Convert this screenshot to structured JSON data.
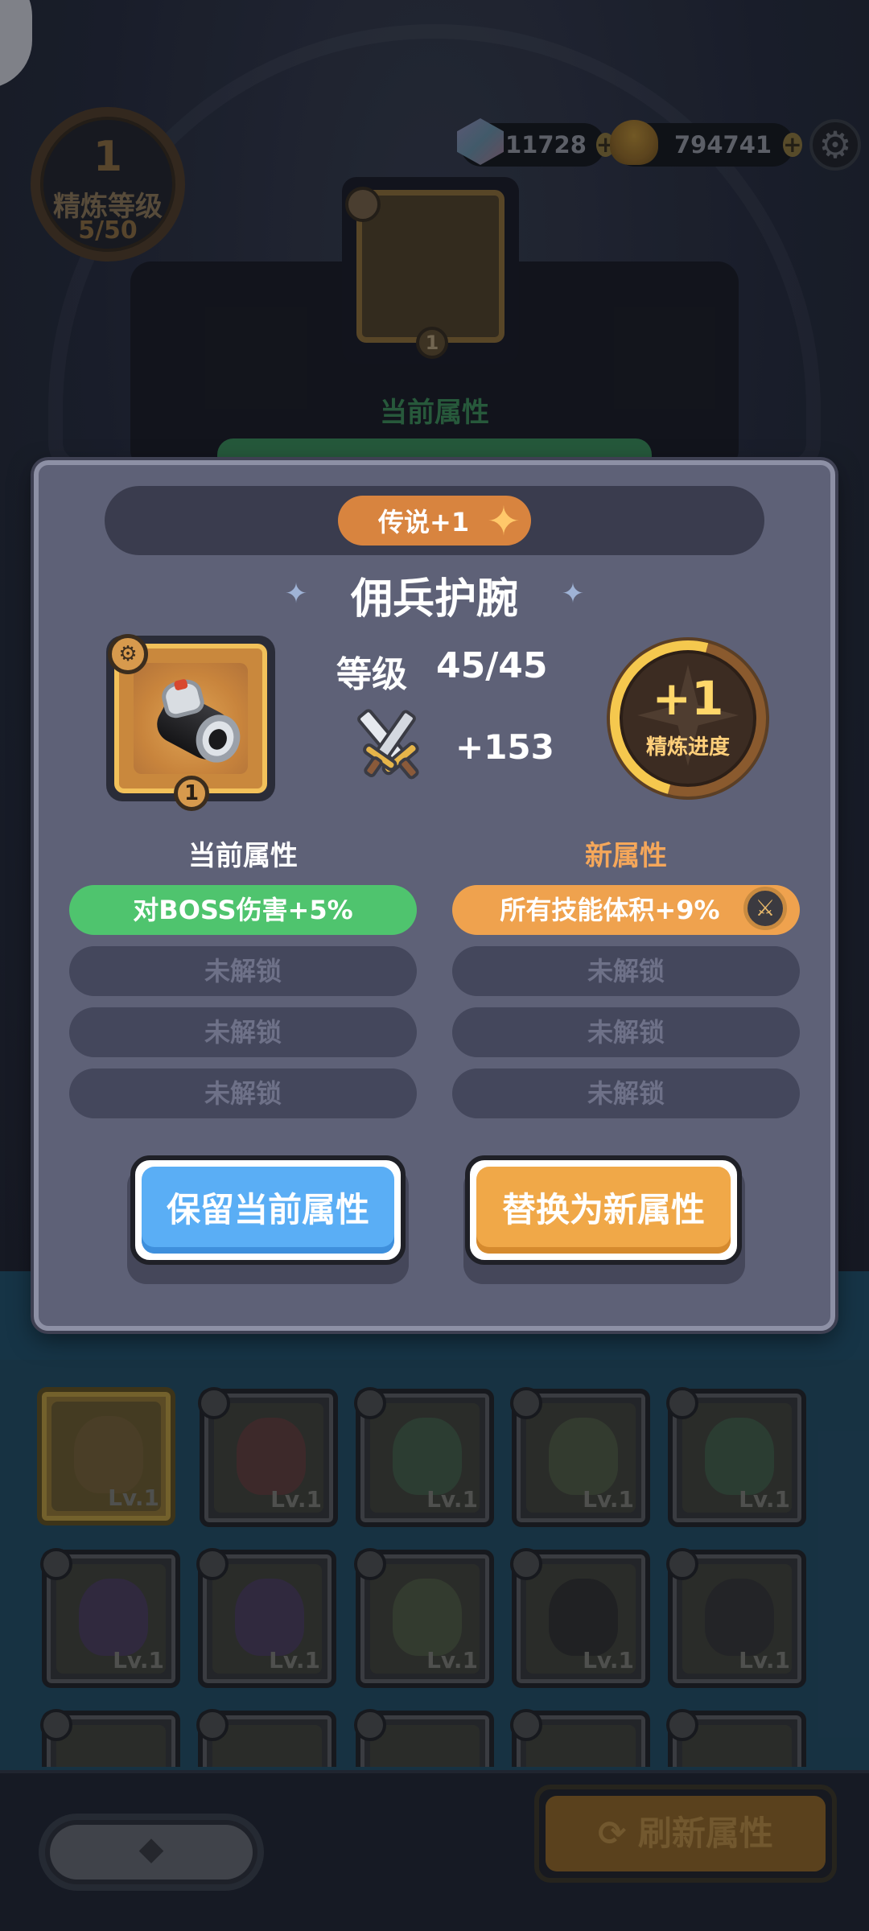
{
  "header": {
    "refine_badge": {
      "level": "1",
      "label": "精炼等级",
      "count": "5/50"
    },
    "gems": "11728",
    "gold": "794741",
    "plus_symbol": "+",
    "gear_symbol": "⚙"
  },
  "background": {
    "current_attr_title": "当前属性",
    "slot_level": "1"
  },
  "modal": {
    "rarity_tag": "传说+1",
    "rarity_spark": "✦",
    "item_name": "佣兵护腕",
    "name_ornament": "✦",
    "item_type_symbol": "⚙",
    "item_level_badge": "1",
    "level_label": "等级",
    "level_value": "45/45",
    "attack_value": "+153",
    "refine_progress": {
      "value": "+1",
      "label": "精炼进度"
    },
    "current_title": "当前属性",
    "new_title": "新属性",
    "current_attrs": [
      "对BOSS伤害+5%",
      "未解锁",
      "未解锁",
      "未解锁"
    ],
    "new_attrs": [
      "所有技能体积+9%",
      "未解锁",
      "未解锁",
      "未解锁"
    ],
    "sword_badge_symbol": "⚔",
    "keep_button": "保留当前属性",
    "replace_button": "替换为新属性"
  },
  "grid": {
    "lv_label": "Lv.1"
  },
  "bottom": {
    "back_symbol": "◆",
    "refresh_button": "⟳ 刷新属性"
  },
  "colors": {
    "attr_green": "#4fc46e",
    "attr_orange": "#efa24e",
    "keep_blue": "#5aaef5",
    "replace_orange": "#f0a848"
  }
}
